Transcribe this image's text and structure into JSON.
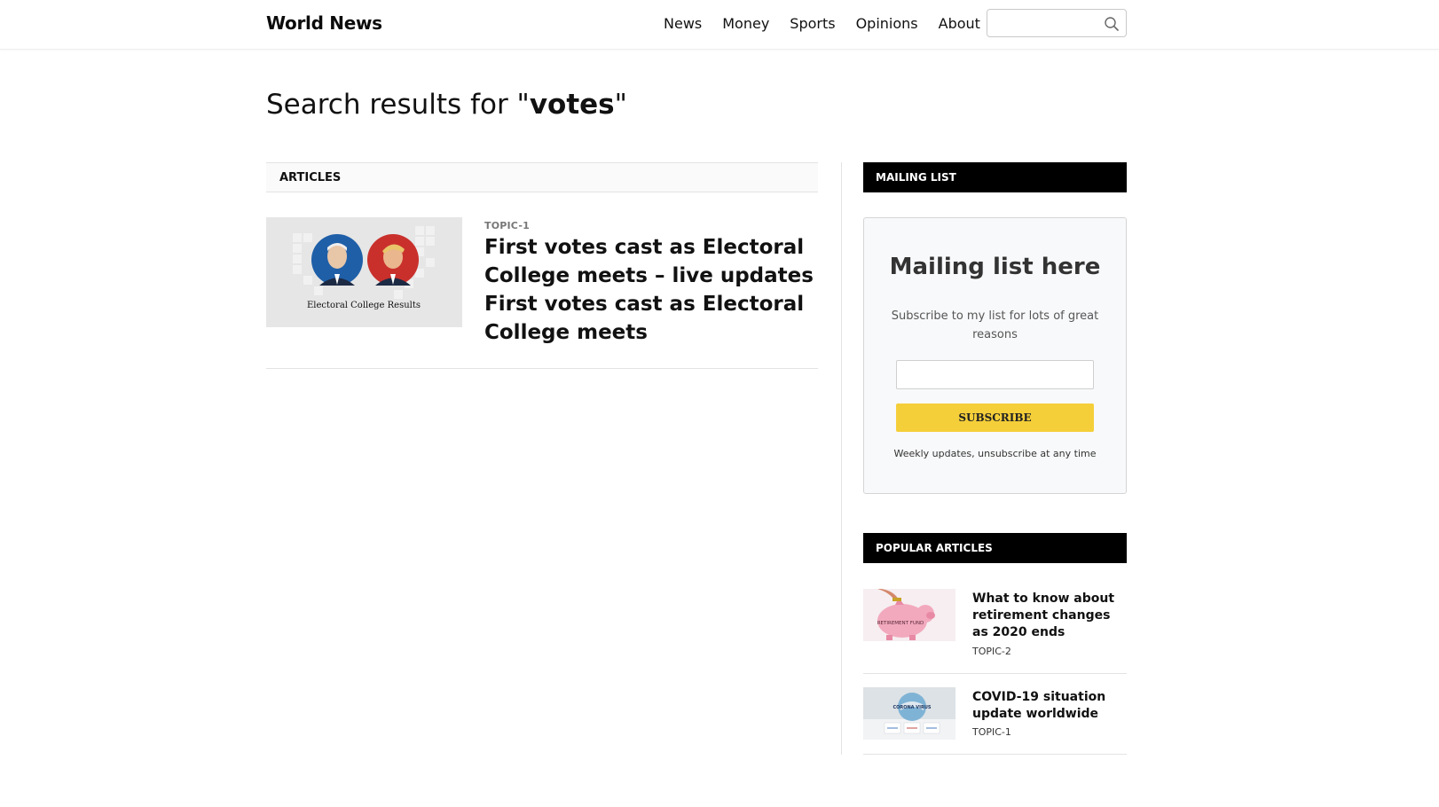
{
  "header": {
    "brand": "World News",
    "nav": [
      "News",
      "Money",
      "Sports",
      "Opinions",
      "About"
    ],
    "search_placeholder": "",
    "search_icon": "search-icon"
  },
  "search": {
    "prefix": "Search results for \"",
    "query": "votes",
    "suffix": "\""
  },
  "articles": {
    "heading": "ARTICLES",
    "items": [
      {
        "topic": "TOPIC-1",
        "title": "First votes cast as Electoral College meets – live updates First votes cast as Electoral College meets",
        "thumb_caption": "Electoral College Results",
        "thumb_colors": {
          "left": "#1f5fa8",
          "right": "#c9302c",
          "bg": "#e6e6e6"
        }
      }
    ]
  },
  "sidebar": {
    "mailing": {
      "heading": "MAILING LIST",
      "title": "Mailing list here",
      "subtitle": "Subscribe to my list for lots of great reasons",
      "email_placeholder": "",
      "button": "SUBSCRIBE",
      "note": "Weekly updates, unsubscribe at any time",
      "button_color": "#f5cf3a"
    },
    "popular": {
      "heading": "POPULAR ARTICLES",
      "items": [
        {
          "title": "What to know about retirement changes as 2020 ends",
          "topic": "TOPIC-2",
          "thumb_text": "RETIREMENT FUND"
        },
        {
          "title": "COVID-19 situation update worldwide",
          "topic": "TOPIC-1",
          "thumb_text": "CORONA VIRUS"
        }
      ]
    }
  }
}
